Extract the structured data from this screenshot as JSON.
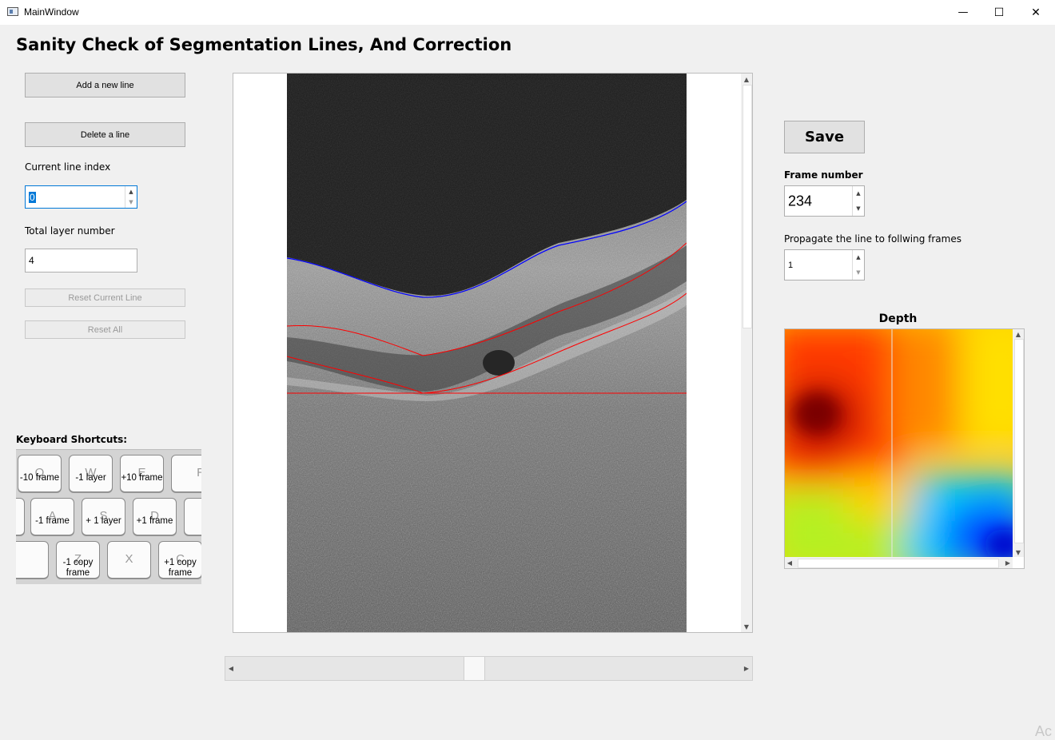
{
  "window": {
    "title": "MainWindow",
    "minimize": "—",
    "maximize": "☐",
    "close": "✕"
  },
  "heading": "Sanity Check of Segmentation Lines, And Correction",
  "left_panel": {
    "add_line": "Add a new line",
    "delete_line": "Delete a line",
    "current_index_label": "Current line index",
    "current_index_value": "0",
    "total_layer_label": "Total layer number",
    "total_layer_value": "4",
    "reset_current": "Reset Current Line",
    "reset_all": "Reset All"
  },
  "shortcuts": {
    "title": "Keyboard Shortcuts:",
    "keys": [
      {
        "letter": "Q",
        "desc": "-10 frame"
      },
      {
        "letter": "W",
        "desc": "-1 layer"
      },
      {
        "letter": "E",
        "desc": "+10 frame"
      },
      {
        "letter": "R",
        "desc": ""
      },
      {
        "letter": "A",
        "desc": "-1 frame"
      },
      {
        "letter": "S",
        "desc": "+ 1 layer"
      },
      {
        "letter": "D",
        "desc": "+1 frame"
      },
      {
        "letter": "Z",
        "desc": "-1 copy\nframe"
      },
      {
        "letter": "X",
        "desc": ""
      },
      {
        "letter": "C",
        "desc": "+1 copy\nframe"
      }
    ]
  },
  "right_panel": {
    "save": "Save",
    "frame_label": "Frame number",
    "frame_value": "234",
    "propagate_label": "Propagate the line to follwing frames",
    "propagate_value": "1",
    "depth_title": "Depth"
  },
  "colors": {
    "line_blue": "#0000ff",
    "line_red": "#ff0000"
  },
  "watermark": "Ac"
}
